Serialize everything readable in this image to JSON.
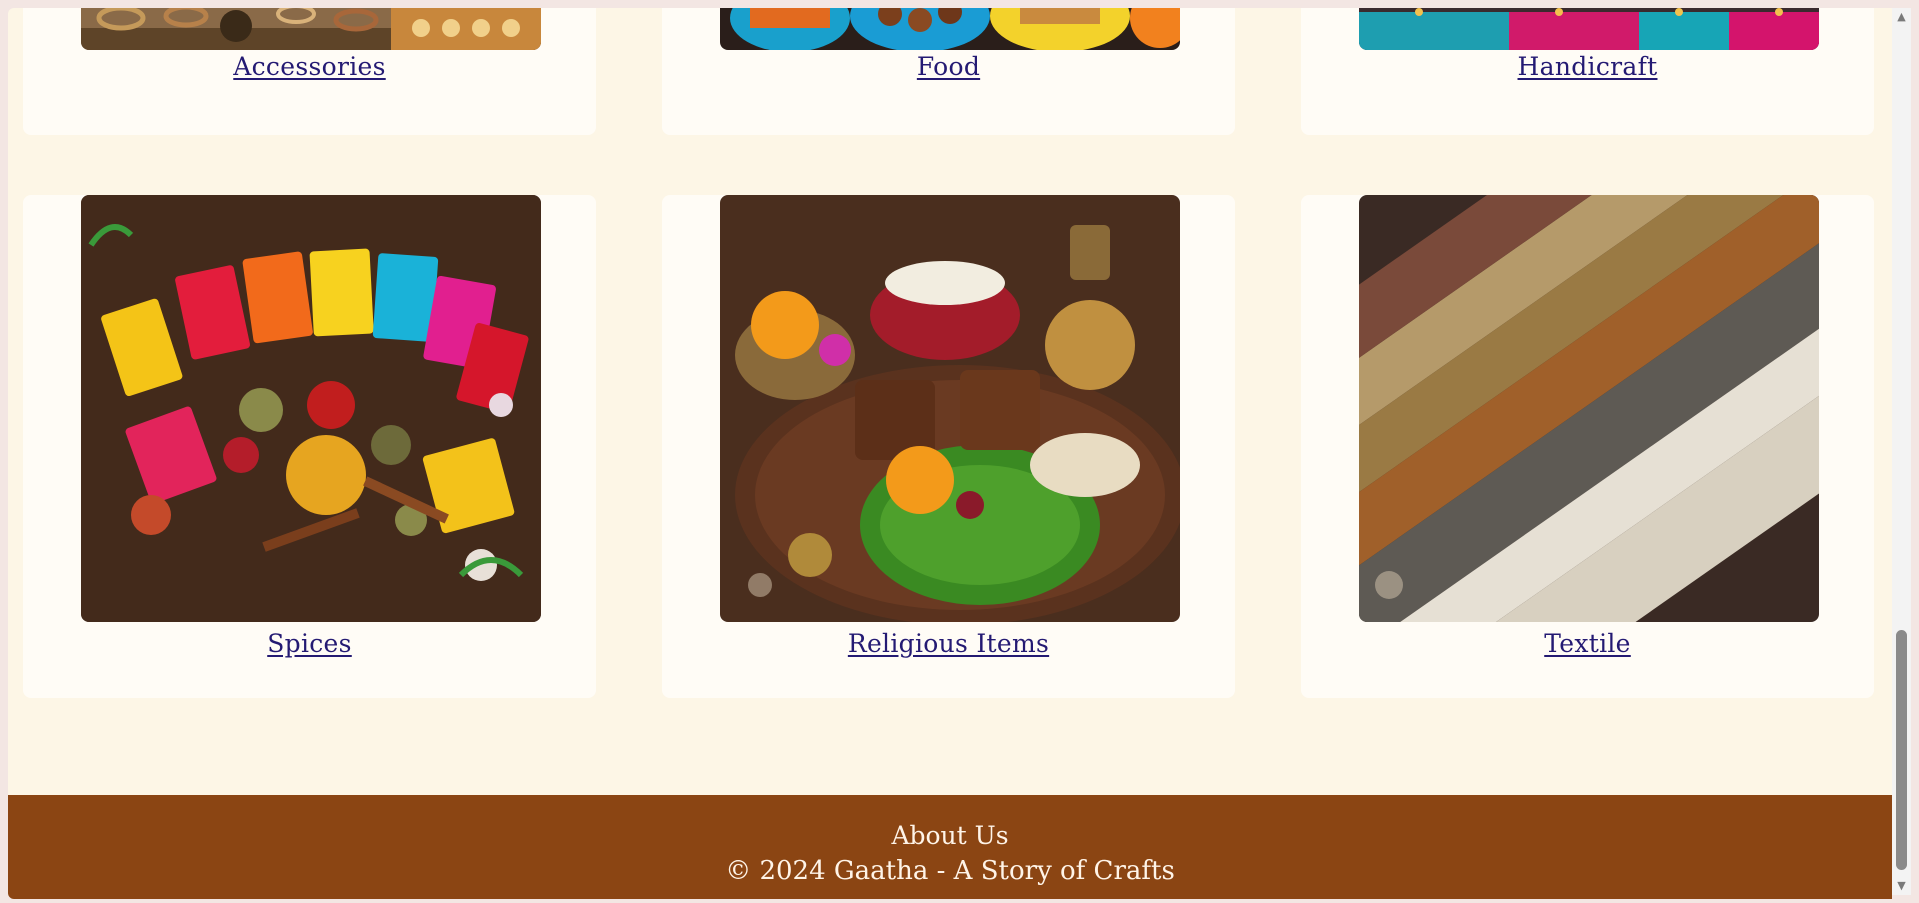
{
  "categories_top": [
    {
      "label": "Accessories",
      "image": "jewelry-bangles-image"
    },
    {
      "label": "Food",
      "image": "indian-sweets-snacks-image"
    },
    {
      "label": "Handicraft",
      "image": "embroidered-textiles-image"
    }
  ],
  "categories_bottom": [
    {
      "label": "Spices",
      "image": "spice-packets-image"
    },
    {
      "label": "Religious Items",
      "image": "puja-thali-image"
    },
    {
      "label": "Textile",
      "image": "silk-fabric-rolls-image"
    }
  ],
  "footer": {
    "about_label": "About Us",
    "copyright": "© 2024 Gaatha - A Story of Crafts"
  },
  "colors": {
    "page_bg": "#fdf6e6",
    "card_bg": "#fffcf6",
    "link": "#241a73",
    "footer_bg": "#8b4513"
  },
  "scrollbar": {
    "up_icon": "▲",
    "down_icon": "▼"
  }
}
